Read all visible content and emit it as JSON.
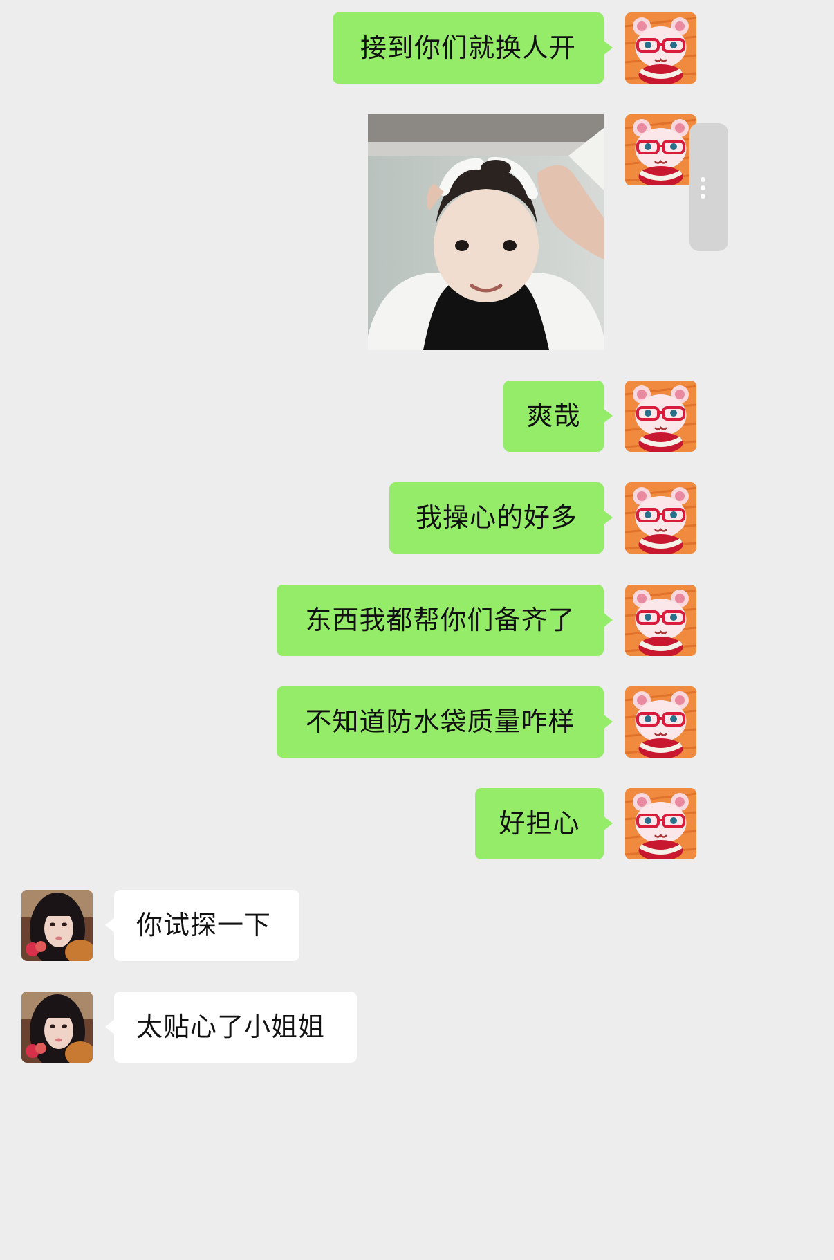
{
  "chat": {
    "messages": [
      {
        "sender": "me",
        "type": "text",
        "text": "接到你们就换人开"
      },
      {
        "sender": "me",
        "type": "image",
        "image": "child-hair-wash-photo"
      },
      {
        "sender": "me",
        "type": "text",
        "text": "爽哉"
      },
      {
        "sender": "me",
        "type": "text",
        "text": "我操心的好多"
      },
      {
        "sender": "me",
        "type": "text",
        "text": "东西我都帮你们备齐了"
      },
      {
        "sender": "me",
        "type": "text",
        "text": "不知道防水袋质量咋样"
      },
      {
        "sender": "me",
        "type": "text",
        "text": "好担心"
      },
      {
        "sender": "other",
        "type": "text",
        "text": "你试探一下"
      },
      {
        "sender": "other",
        "type": "text",
        "text": "太贴心了小姐姐"
      }
    ]
  },
  "avatars": {
    "me": "pink-bear-glasses-avatar",
    "other": "girl-photo-avatar"
  },
  "colors": {
    "background": "#ededed",
    "outgoing_bubble": "#95ec69",
    "incoming_bubble": "#ffffff"
  }
}
